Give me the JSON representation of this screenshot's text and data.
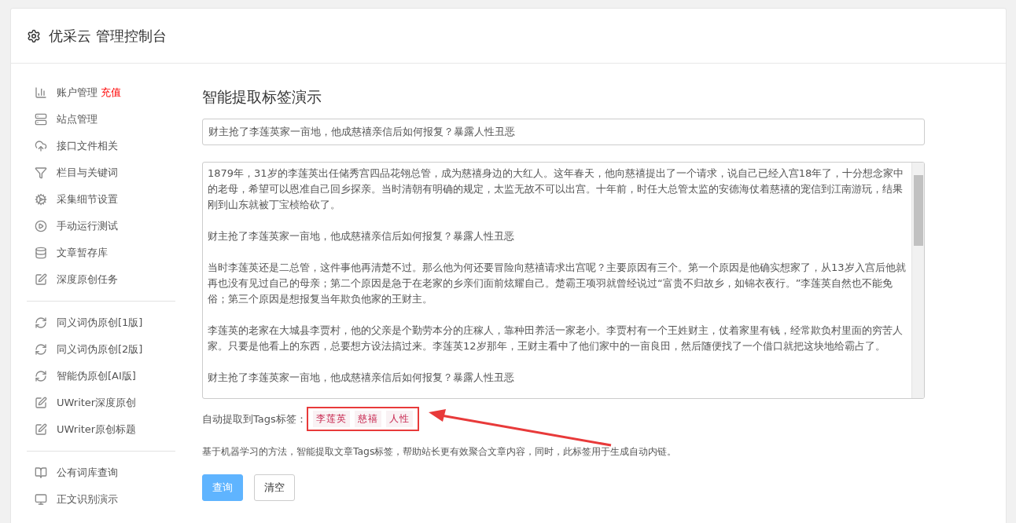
{
  "header": {
    "title": "优采云 管理控制台"
  },
  "sidebar": {
    "sections": [
      {
        "items": [
          {
            "label": "账户管理",
            "badge": "充值"
          },
          {
            "label": "站点管理"
          },
          {
            "label": "接口文件相关"
          },
          {
            "label": "栏目与关键词"
          },
          {
            "label": "采集细节设置"
          },
          {
            "label": "手动运行测试"
          },
          {
            "label": "文章暂存库"
          },
          {
            "label": "深度原创任务"
          }
        ]
      },
      {
        "items": [
          {
            "label": "同义词伪原创[1版]"
          },
          {
            "label": "同义词伪原创[2版]"
          },
          {
            "label": "智能伪原创[AI版]"
          },
          {
            "label": "UWriter深度原创"
          },
          {
            "label": "UWriter原创标题"
          }
        ]
      },
      {
        "items": [
          {
            "label": "公有词库查询"
          },
          {
            "label": "正文识别演示"
          }
        ]
      }
    ]
  },
  "main": {
    "title": "智能提取标签演示",
    "title_field": {
      "value": "财主抢了李莲英家一亩地，他成慈禧亲信后如何报复？暴露人性丑恶"
    },
    "content_field": {
      "paragraphs": [
        "1879年，31岁的李莲英出任储秀宫四品花翎总管，成为慈禧身边的大红人。这年春天，他向慈禧提出了一个请求，说自己已经入宫18年了，十分想念家中的老母，希望可以恩准自己回乡探亲。当时清朝有明确的规定，太监无故不可以出宫。十年前，时任大总管太监的安德海仗着慈禧的宠信到江南游玩，结果刚到山东就被丁宝桢给砍了。",
        "财主抢了李莲英家一亩地，他成慈禧亲信后如何报复？暴露人性丑恶",
        "当时李莲英还是二总管，这件事他再清楚不过。那么他为何还要冒险向慈禧请求出宫呢？主要原因有三个。第一个原因是他确实想家了，从13岁入宫后他就再也没有见过自己的母亲；第二个原因是急于在老家的乡亲们面前炫耀自己。楚霸王项羽就曾经说过“富贵不归故乡，如锦衣夜行。”李莲英自然也不能免俗；第三个原因是想报复当年欺负他家的王财主。",
        "李莲英的老家在大城县李贾村，他的父亲是个勤劳本分的庄稼人，靠种田养活一家老小。李贾村有一个王姓财主，仗着家里有钱，经常欺负村里面的穷苦人家。只要是他看上的东西，总要想方设法搞过来。李莲英12岁那年，王财主看中了他们家中的一亩良田，然后随便找了一个借口就把这块地给霸占了。",
        "财主抢了李莲英家一亩地，他成慈禧亲信后如何报复？暴露人性丑恶"
      ]
    },
    "tags": {
      "label": "自动提取到Tags标签：",
      "items": [
        "李莲英",
        "慈禧",
        "人性"
      ]
    },
    "description": "基于机器学习的方法，智能提取文章Tags标签，帮助站长更有效聚合文章内容，同时，此标签用于生成自动内链。",
    "buttons": [
      {
        "label": "查询",
        "kind": "primary"
      },
      {
        "label": "清空",
        "kind": "default"
      }
    ]
  }
}
